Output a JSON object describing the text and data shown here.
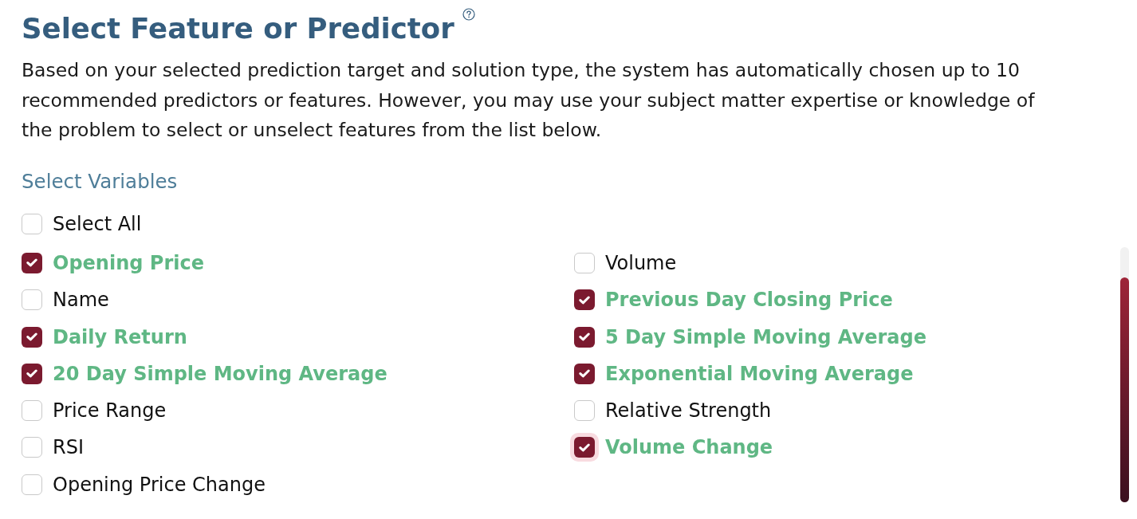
{
  "header": {
    "title": "Select Feature or Predictor",
    "description": "Based on your selected prediction target and solution type, the system has automatically chosen up to 10 recommended predictors or features. However, you may use your subject matter expertise or knowledge of the problem to select or unselect features from the list below."
  },
  "variables": {
    "label": "Select Variables",
    "select_all": {
      "label": "Select All",
      "checked": false
    },
    "columns": [
      {
        "items": [
          {
            "label": "Opening Price",
            "checked": true,
            "focused": false
          },
          {
            "label": "Name",
            "checked": false,
            "focused": false
          },
          {
            "label": "Daily Return",
            "checked": true,
            "focused": false
          },
          {
            "label": "20 Day Simple Moving Average",
            "checked": true,
            "focused": false
          },
          {
            "label": "Price Range",
            "checked": false,
            "focused": false
          },
          {
            "label": "RSI",
            "checked": false,
            "focused": false
          },
          {
            "label": "Opening Price Change",
            "checked": false,
            "focused": false
          }
        ]
      },
      {
        "items": [
          {
            "label": "Volume",
            "checked": false,
            "focused": false
          },
          {
            "label": "Previous Day Closing Price",
            "checked": true,
            "focused": false
          },
          {
            "label": "5 Day Simple Moving Average",
            "checked": true,
            "focused": false
          },
          {
            "label": "Exponential Moving Average",
            "checked": true,
            "focused": false
          },
          {
            "label": "Relative Strength",
            "checked": false,
            "focused": false
          },
          {
            "label": "Volume Change",
            "checked": true,
            "focused": true
          }
        ]
      }
    ]
  }
}
